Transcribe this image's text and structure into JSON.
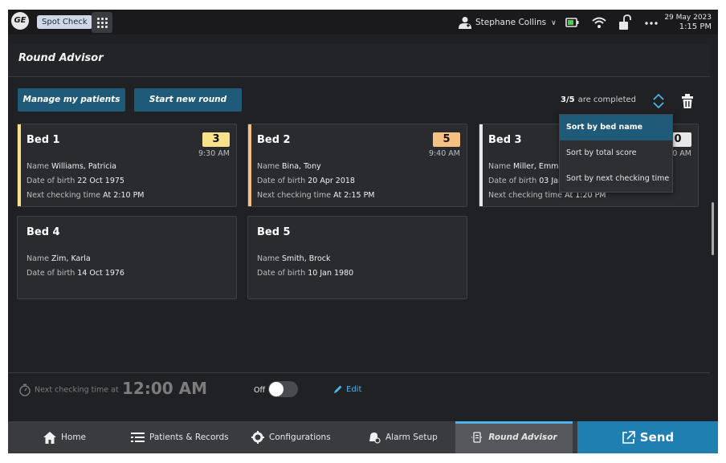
{
  "topbar": {
    "logo": "GE",
    "app_name": "Spot Check",
    "user_name": "Stephane Collins",
    "date": "29 May 2023",
    "time": "1:15 PM",
    "icons": [
      "ge-logo-icon",
      "apps-grid-icon",
      "clinician-user-icon",
      "chevron-down-icon",
      "battery-icon",
      "wifi-icon",
      "unlock-icon",
      "more-icon"
    ]
  },
  "panel": {
    "title": "Round Advisor",
    "manage_label": "Manage my patients",
    "start_label": "Start new round",
    "completed_count": "3/5",
    "completed_text": "are completed"
  },
  "sort_menu": {
    "options": [
      "Sort by bed name",
      "Sort by total score",
      "Sort by next checking time"
    ],
    "selected": "Sort by bed name"
  },
  "labels": {
    "name": "Name",
    "dob": "Date of birth",
    "next": "Next checking time"
  },
  "beds": [
    {
      "bed": "Bed 1",
      "score": "3",
      "score_color": "#f7e18a",
      "accent": "#f7e18a",
      "time": "9:30 AM",
      "name": "Williams, Patricia",
      "dob": "22 Oct 1975",
      "next": "At 2:10 PM"
    },
    {
      "bed": "Bed 2",
      "score": "5",
      "score_color": "#f6c083",
      "accent": "#f6c083",
      "time": "9:40 AM",
      "name": "Bina, Tony",
      "dob": "20 Apr 2018",
      "next": "At 2:15 PM"
    },
    {
      "bed": "Bed 3",
      "score": "0",
      "score_color": "#e8e8e8",
      "accent": "#e8e8e8",
      "time": "50 AM",
      "name": "Miller, Emma",
      "dob": "03 Jan",
      "next": "At 1:20 PM"
    },
    {
      "bed": "Bed 4",
      "name": "Zim, Karla",
      "dob": "14 Oct 1976"
    },
    {
      "bed": "Bed 5",
      "name": "Smith, Brock",
      "dob": "10 Jan 1980"
    }
  ],
  "controls": {
    "next_label": "Next checking time at",
    "next_time": "12:00 AM",
    "toggle_label": "Off",
    "edit_label": "Edit"
  },
  "nav": {
    "home": "Home",
    "patients": "Patients & Records",
    "configurations": "Configurations",
    "alarm": "Alarm Setup",
    "round": "Round Advisor",
    "send": "Send"
  },
  "colors": {
    "accent_blue": "#1f5a78",
    "send_blue": "#1f7fb0",
    "link_blue": "#4fb3e8"
  }
}
